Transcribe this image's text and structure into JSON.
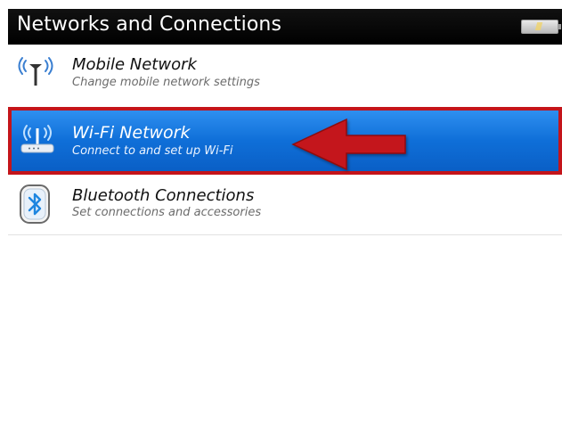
{
  "window": {
    "title": "Networks and Connections"
  },
  "status": {
    "battery_icon": "battery-charging-icon"
  },
  "menu": {
    "items": [
      {
        "label": "Mobile Network",
        "subtitle": "Change mobile network settings",
        "icon": "antenna-icon",
        "selected": false
      },
      {
        "label": "Wi-Fi Network",
        "subtitle": "Connect to and set up Wi-Fi",
        "icon": "wifi-router-icon",
        "selected": true
      },
      {
        "label": "Bluetooth Connections",
        "subtitle": "Set connections and accessories",
        "icon": "bluetooth-icon",
        "selected": false
      }
    ]
  },
  "annotation": {
    "icon": "red-arrow-icon",
    "color": "#c4141a"
  },
  "colors": {
    "title_bar": "#000000",
    "selection_blue": "#0f6fd8",
    "highlight_red": "#c4141a"
  }
}
